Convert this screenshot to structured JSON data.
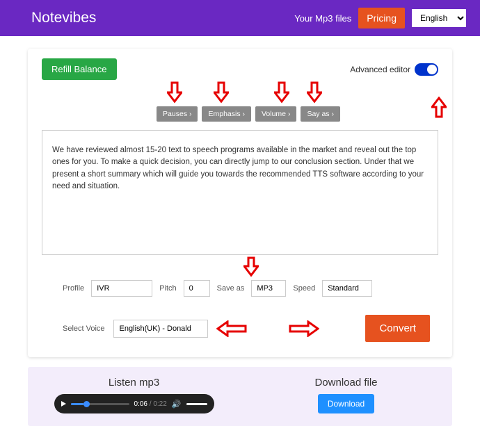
{
  "header": {
    "brand": "Notevibes",
    "mp3_link": "Your Mp3 files",
    "pricing": "Pricing",
    "language": "English"
  },
  "card": {
    "refill": "Refill Balance",
    "advanced_label": "Advanced editor",
    "tags": {
      "pauses": "Pauses  ›",
      "emphasis": "Emphasis  ›",
      "volume": "Volume  ›",
      "sayas": "Say as  ›"
    },
    "editor_text": "We have reviewed almost 15-20 text to speech programs available in the market and reveal out the top ones for you. To make a quick decision, you can directly jump to our conclusion section. Under that we present a short summary which will guide you towards the recommended TTS software according to your need and situation.",
    "controls": {
      "profile_label": "Profile",
      "profile_value": "IVR",
      "pitch_label": "Pitch",
      "pitch_value": "0",
      "saveas_label": "Save as",
      "saveas_value": "MP3",
      "speed_label": "Speed",
      "speed_value": "Standard"
    },
    "voice": {
      "label": "Select Voice",
      "value": "English(UK) - Donald"
    },
    "convert": "Convert"
  },
  "bottom": {
    "listen_title": "Listen mp3",
    "download_title": "Download file",
    "download_btn": "Download",
    "player": {
      "current": "0:06",
      "duration": " / 0:22"
    }
  }
}
